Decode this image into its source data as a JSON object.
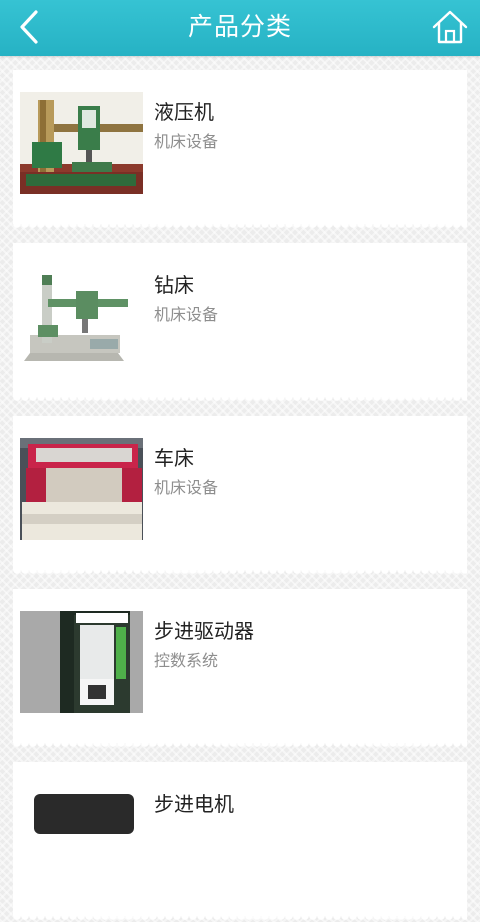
{
  "header": {
    "title": "产品分类",
    "back_icon": "chevron-left-icon",
    "home_icon": "home-icon"
  },
  "colors": {
    "header_bg": "#2cb9cb",
    "title_text": "#ffffff",
    "item_title": "#222222",
    "item_subtitle": "#8e8e8e"
  },
  "products": [
    {
      "title": "液压机",
      "subtitle": "机床设备",
      "image": "hydraulic-press-image"
    },
    {
      "title": "钻床",
      "subtitle": "机床设备",
      "image": "drilling-machine-image"
    },
    {
      "title": "车床",
      "subtitle": "机床设备",
      "image": "lathe-image"
    },
    {
      "title": "步进驱动器",
      "subtitle": "控数系统",
      "image": "stepper-driver-image"
    },
    {
      "title": "步进电机",
      "subtitle": "",
      "image": "stepper-motor-image"
    }
  ]
}
